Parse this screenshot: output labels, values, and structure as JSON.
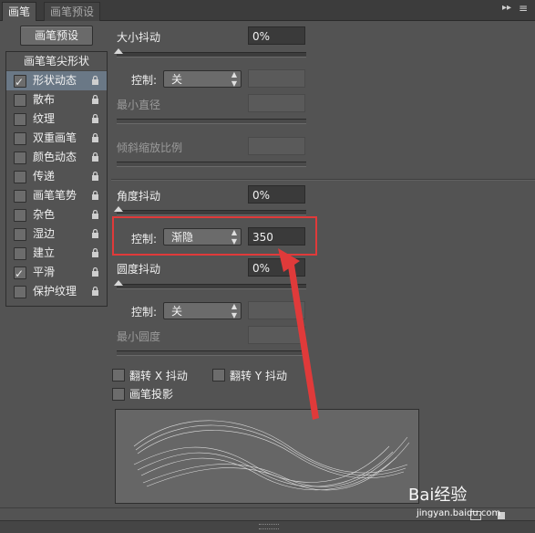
{
  "tabs": {
    "active": "画笔",
    "inactive": "画笔预设"
  },
  "tabbar_menu_icon": "double-chevron-right-icon",
  "tabbar_list_icon": "menu-list-icon",
  "preset_button": "画笔预设",
  "list_header": "画笔笔尖形状",
  "items": [
    {
      "label": "形状动态",
      "checked": true
    },
    {
      "label": "散布",
      "checked": false
    },
    {
      "label": "纹理",
      "checked": false
    },
    {
      "label": "双重画笔",
      "checked": false
    },
    {
      "label": "颜色动态",
      "checked": false
    },
    {
      "label": "传递",
      "checked": false
    },
    {
      "label": "画笔笔势",
      "checked": false
    },
    {
      "label": "杂色",
      "checked": false
    },
    {
      "label": "湿边",
      "checked": false
    },
    {
      "label": "建立",
      "checked": false
    },
    {
      "label": "平滑",
      "checked": true
    },
    {
      "label": "保护纹理",
      "checked": false
    }
  ],
  "size_jitter": {
    "label": "大小抖动",
    "value": "0%"
  },
  "control1": {
    "label": "控制:",
    "value": "关"
  },
  "min_diameter": {
    "label": "最小直径"
  },
  "tilt_scale": {
    "label": "倾斜缩放比例"
  },
  "angle_jitter": {
    "label": "角度抖动",
    "value": "0%"
  },
  "control2": {
    "label": "控制:",
    "value": "渐隐",
    "amount": "350"
  },
  "roundness_jitter": {
    "label": "圆度抖动",
    "value": "0%"
  },
  "control3": {
    "label": "控制:",
    "value": "关"
  },
  "min_roundness": {
    "label": "最小圆度"
  },
  "flip_x": "翻转 X 抖动",
  "flip_y": "翻转 Y 抖动",
  "brush_projection": "画笔投影",
  "watermark": {
    "main": "Bai经验",
    "url": "jingyan.baidu.com"
  },
  "colors": {
    "highlight": "#e03a3a",
    "selected": "#6a7886"
  }
}
